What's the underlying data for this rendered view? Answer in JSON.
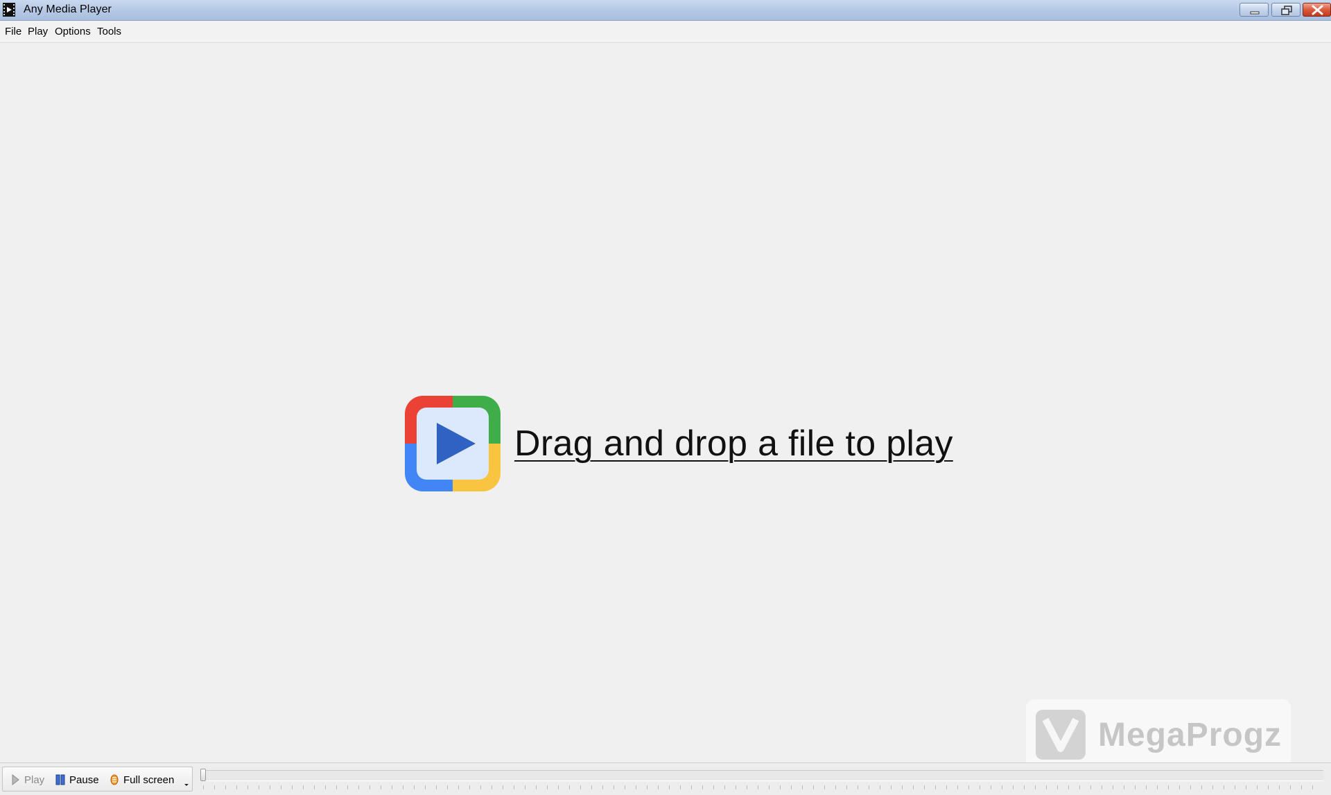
{
  "window": {
    "title": "Any Media Player",
    "caption_buttons": [
      "minimize-icon",
      "restore-icon",
      "close-icon"
    ]
  },
  "menu": {
    "items": [
      {
        "label": "File"
      },
      {
        "label": "Play"
      },
      {
        "label": "Options"
      },
      {
        "label": "Tools"
      }
    ]
  },
  "content": {
    "drop_text": "Drag and drop a file to play",
    "logo_icon": "play-logo-icon",
    "logo_colors": {
      "red": "#ea4335",
      "green": "#34a853",
      "blue": "#4285f4",
      "yellow": "#fbbc05",
      "inner": "#dce8fb",
      "triangle": "#3367c8"
    }
  },
  "watermark": {
    "text": "MegaProgz"
  },
  "controls": {
    "play_label": "Play",
    "pause_label": "Pause",
    "fullscreen_label": "Full screen",
    "seek_position": 0
  }
}
